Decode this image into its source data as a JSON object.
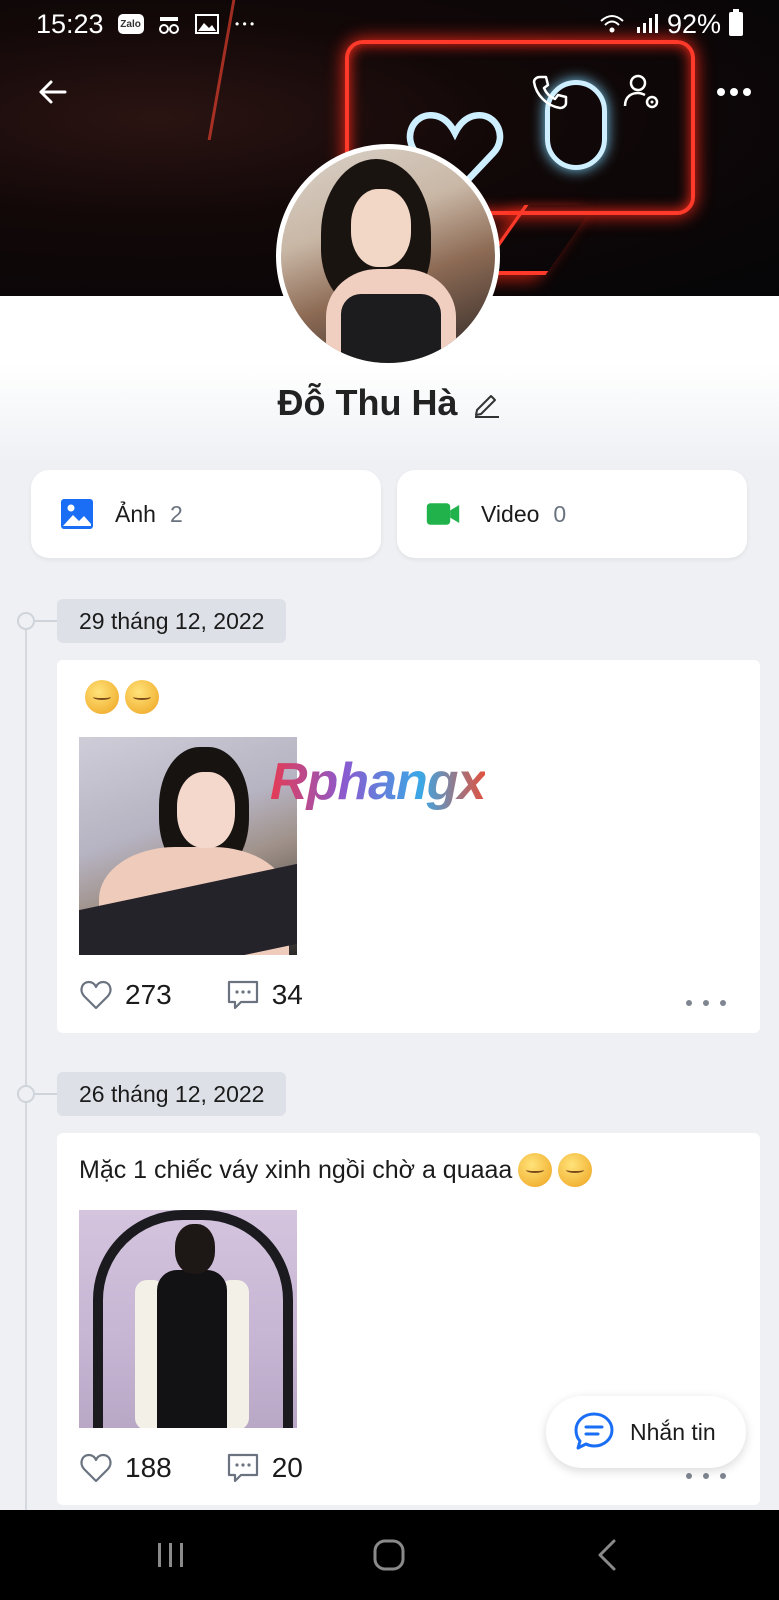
{
  "status_bar": {
    "time": "15:23",
    "zalo_icon": "zalo-notification-icon",
    "battery": "92%"
  },
  "top_bar": {
    "back_icon": "arrow-left-icon",
    "call_icon": "phone-icon",
    "settings_icon": "user-settings-icon",
    "more_icon": "more-horizontal-icon"
  },
  "profile": {
    "name": "Đỗ Thu Hà"
  },
  "media": {
    "photos": {
      "label": "Ảnh",
      "count": "2"
    },
    "videos": {
      "label": "Video",
      "count": "0"
    }
  },
  "posts": [
    {
      "date": "29 tháng 12, 2022",
      "text": "",
      "likes": "273",
      "comments": "34"
    },
    {
      "date": "26 tháng 12, 2022",
      "text": "Mặc 1 chiếc váy xinh ngồi chờ a quaaa",
      "likes": "188",
      "comments": "20"
    }
  ],
  "watermark": "Rphangx",
  "fab": {
    "label": "Nhắn tin"
  },
  "colors": {
    "accent_blue": "#1a6ef5",
    "video_green": "#22b24c",
    "background": "#eef0f4"
  }
}
